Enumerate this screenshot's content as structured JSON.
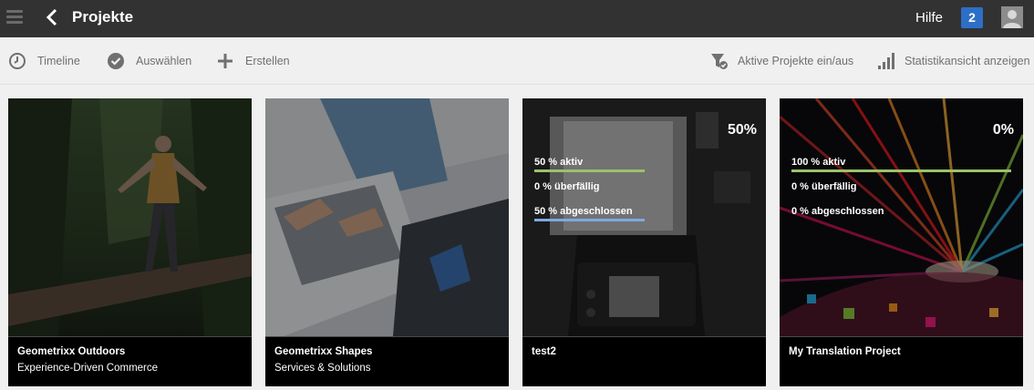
{
  "header": {
    "title": "Projekte",
    "help_label": "Hilfe",
    "notification_count": "2"
  },
  "toolbar": {
    "timeline_label": "Timeline",
    "select_label": "Auswählen",
    "create_label": "Erstellen",
    "toggle_active_label": "Aktive Projekte ein/aus",
    "stats_label": "Statistikansicht anzeigen"
  },
  "colors": {
    "header_bg": "#323232",
    "badge_blue": "#2d6fc7",
    "active_bar": "#9bc26a",
    "done_bar": "#7fa9e0"
  },
  "cards": [
    {
      "title": "Geometrixx Outdoors",
      "subtitle": "Experience-Driven Commerce",
      "thumb": "hiker-on-log"
    },
    {
      "title": "Geometrixx Shapes",
      "subtitle": "Services & Solutions",
      "thumb": "laptop-typing"
    },
    {
      "title": "test2",
      "percent": "50%",
      "thumb": "camera-studio",
      "stats": {
        "active": "50 % aktiv",
        "overdue": "0 % überfällig",
        "done": "50 % abgeschlossen"
      },
      "active_fraction": 0.5,
      "done_fraction": 0.5
    },
    {
      "title": "My Translation Project",
      "percent": "0%",
      "thumb": "colorful-light-burst",
      "stats": {
        "active": "100 % aktiv",
        "overdue": "0 % überfällig",
        "done": "0 % abgeschlossen"
      },
      "active_fraction": 1.0,
      "done_fraction": 0
    }
  ]
}
